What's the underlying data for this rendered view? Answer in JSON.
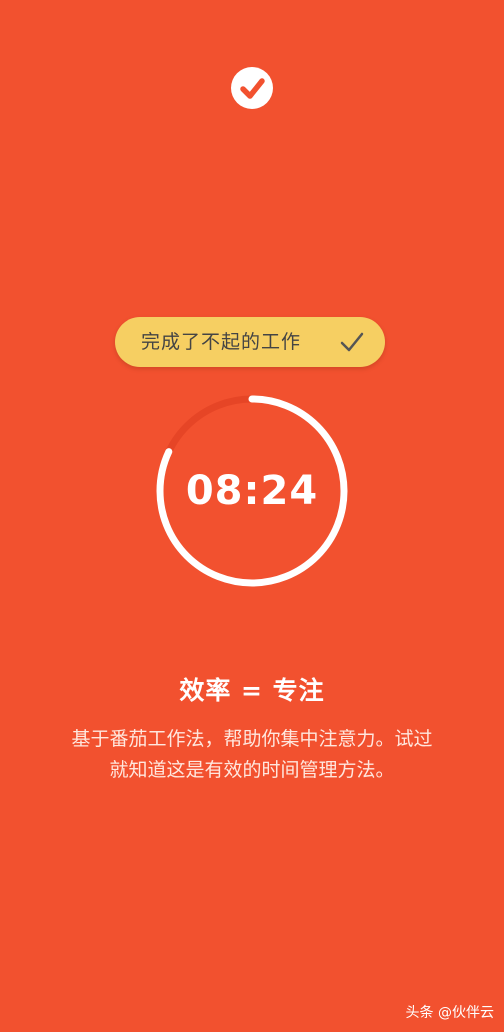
{
  "colors": {
    "background": "#f2512f",
    "pill": "#f6cf62",
    "ring_progress": "#ffffff",
    "ring_track": "#e64526"
  },
  "header": {
    "logo_icon": "check-circle-icon"
  },
  "task": {
    "title": "完成了不起的工作",
    "check_icon": "checkmark-icon"
  },
  "timer": {
    "time": "08:24",
    "progress": 0.82
  },
  "intro": {
    "headline": "效率 = 专注",
    "line1": "基于番茄工作法，帮助你集中注意力。试过",
    "line2": "就知道这是有效的时间管理方法。"
  },
  "watermark": {
    "text": "头条 @伙伴云"
  }
}
